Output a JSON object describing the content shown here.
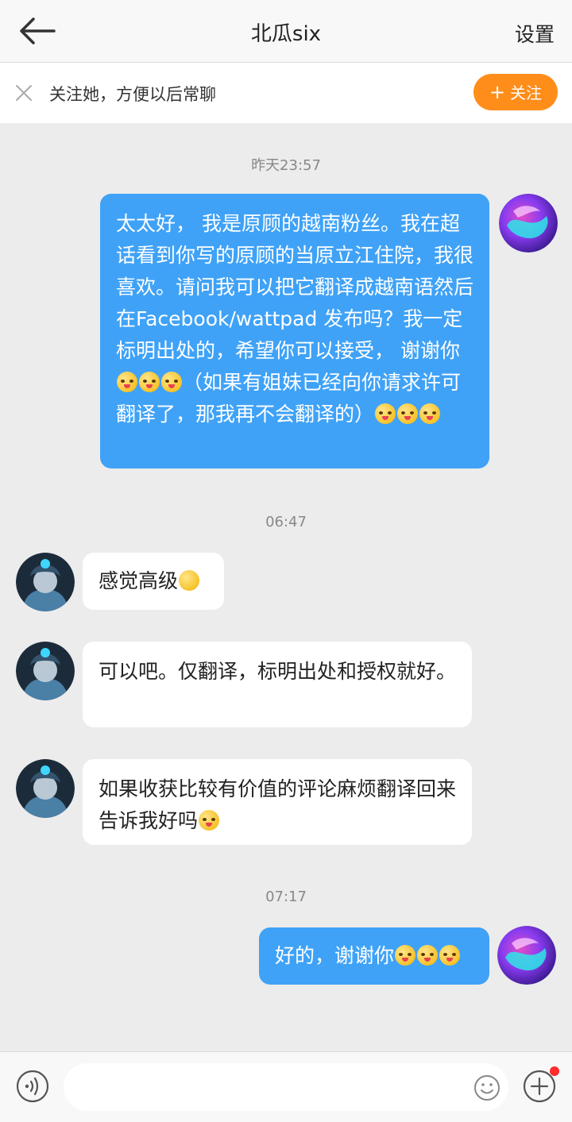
{
  "header": {
    "title": "北瓜six",
    "settings_label": "设置"
  },
  "follow_bar": {
    "text": "关注她，方便以后常聊",
    "button_label": "关注"
  },
  "messages": [
    {
      "type": "timestamp",
      "text": "昨天23:57"
    },
    {
      "type": "outgoing",
      "text": "太太好， 我是原顾的越南粉丝。我在超话看到你写的原顾的当原立江住院，我很喜欢。请问我可以把它翻译成越南语然后在Facebook/wattpad 发布吗？我一定标明出处的，希望你可以接受， 谢谢你",
      "text2": "（如果有姐妹已经向你请求许可翻译了，那我再不会翻译的）"
    },
    {
      "type": "timestamp",
      "text": "06:47"
    },
    {
      "type": "incoming",
      "text": "感觉高级"
    },
    {
      "type": "incoming",
      "text": "可以吧。仅翻译，标明出处和授权就好。"
    },
    {
      "type": "incoming",
      "text": "如果收获比较有价值的评论麻烦翻译回来告诉我好吗"
    },
    {
      "type": "timestamp",
      "text": "07:17"
    },
    {
      "type": "outgoing",
      "text": "好的，谢谢你"
    }
  ],
  "input": {
    "placeholder": ""
  },
  "colors": {
    "outgoing_bubble": "#3fa2f7",
    "follow_button": "#ff8d1a",
    "notification_dot": "#ff2a2a"
  }
}
